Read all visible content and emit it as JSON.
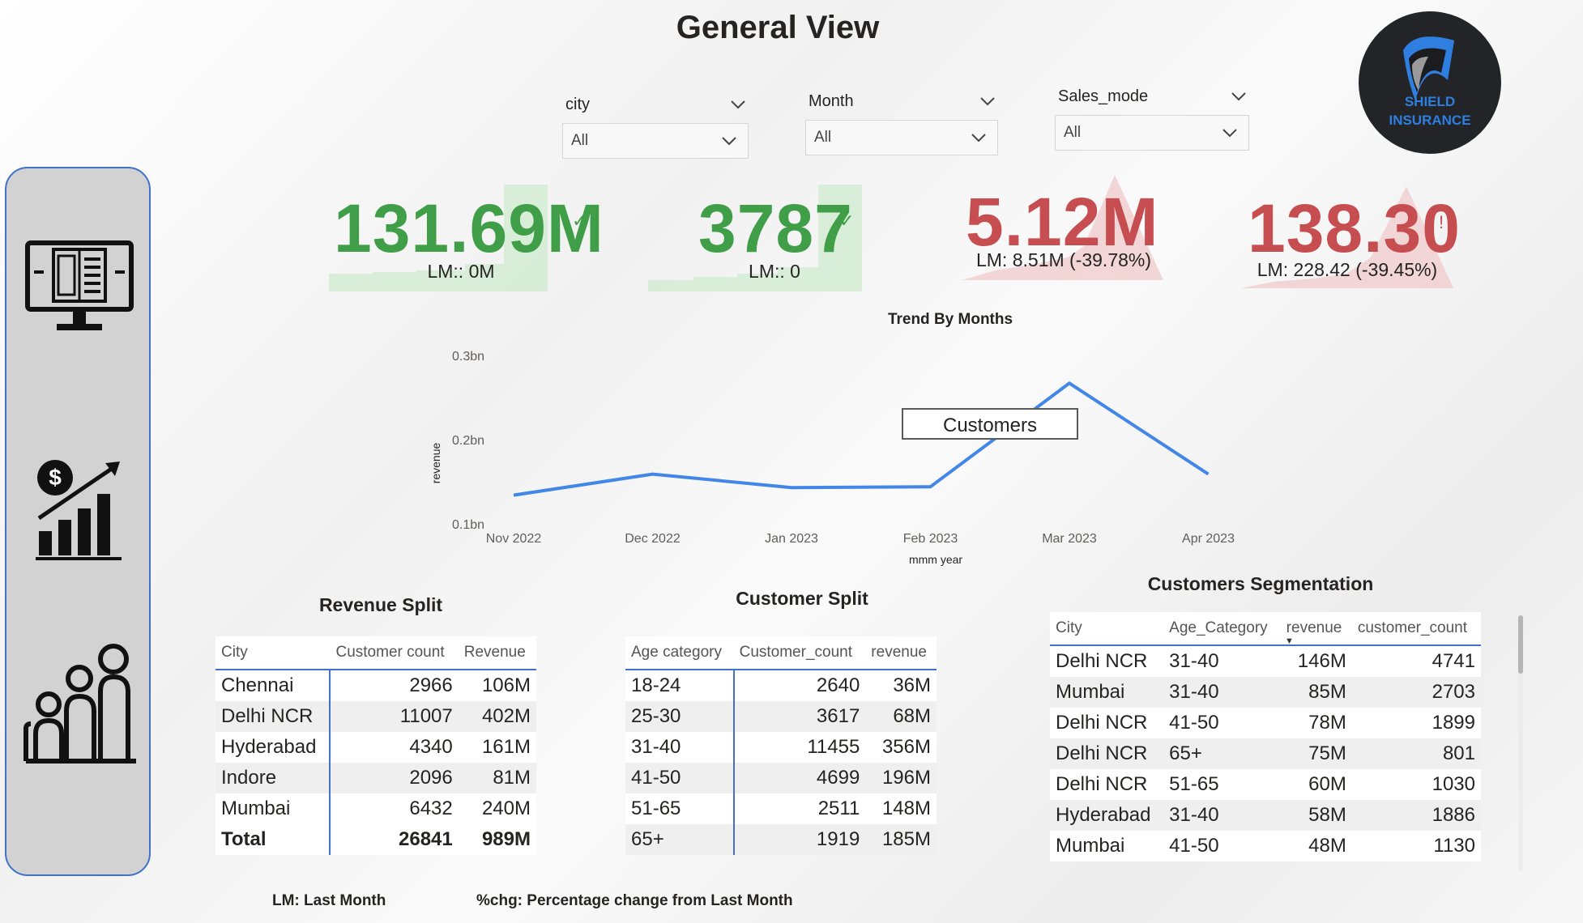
{
  "title": "General View",
  "logo": {
    "line1": "SHIELD",
    "line2": "INSURANCE"
  },
  "slicers": [
    {
      "label": "city",
      "value": "All"
    },
    {
      "label": "Month",
      "value": "All"
    },
    {
      "label": "Sales_mode",
      "value": "All"
    }
  ],
  "kpis": [
    {
      "value": "131.69M",
      "lm": "LM:: 0M",
      "status": "good"
    },
    {
      "value": "3787",
      "lm": "LM:: 0",
      "status": "good"
    },
    {
      "value": "5.12M",
      "lm": "LM: 8.51M (-39.78%)",
      "status": "bad"
    },
    {
      "value": "138.30",
      "lm": "LM: 228.42 (-39.45%)",
      "status": "bad"
    }
  ],
  "chart_data": {
    "type": "line",
    "title": "Trend By Months",
    "xlabel": "mmm year",
    "ylabel": "revenue",
    "categories": [
      "Nov 2022",
      "Dec 2022",
      "Jan 2023",
      "Feb 2023",
      "Mar 2023",
      "Apr 2023"
    ],
    "series": [
      {
        "values": [
          0.135,
          0.16,
          0.144,
          0.145,
          0.268,
          0.16
        ]
      }
    ],
    "yticks": [
      "0.1bn",
      "0.2bn",
      "0.3bn"
    ],
    "ylim": [
      0.1,
      0.3
    ],
    "annotation": "Customers",
    "color": "#4286e8"
  },
  "revenue_split": {
    "title": "Revenue Split",
    "headers": [
      "City",
      "Customer count",
      "Revenue"
    ],
    "rows": [
      [
        "Chennai",
        "2966",
        "106M"
      ],
      [
        "Delhi NCR",
        "11007",
        "402M"
      ],
      [
        "Hyderabad",
        "4340",
        "161M"
      ],
      [
        "Indore",
        "2096",
        "81M"
      ],
      [
        "Mumbai",
        "6432",
        "240M"
      ]
    ],
    "total": [
      "Total",
      "26841",
      "989M"
    ]
  },
  "customer_split": {
    "title": "Customer Split",
    "headers": [
      "Age category",
      "Customer_count",
      "revenue"
    ],
    "rows": [
      [
        "18-24",
        "2640",
        "36M"
      ],
      [
        "25-30",
        "3617",
        "68M"
      ],
      [
        "31-40",
        "11455",
        "356M"
      ],
      [
        "41-50",
        "4699",
        "196M"
      ],
      [
        "51-65",
        "2511",
        "148M"
      ],
      [
        "65+",
        "1919",
        "185M"
      ]
    ]
  },
  "segmentation": {
    "title": "Customers Segmentation",
    "headers": [
      "City",
      "Age_Category",
      "revenue",
      "customer_count"
    ],
    "rows": [
      [
        "Delhi NCR",
        "31-40",
        "146M",
        "4741"
      ],
      [
        "Mumbai",
        "31-40",
        "85M",
        "2703"
      ],
      [
        "Delhi NCR",
        "41-50",
        "78M",
        "1899"
      ],
      [
        "Delhi NCR",
        "65+",
        "75M",
        "801"
      ],
      [
        "Delhi NCR",
        "51-65",
        "60M",
        "1030"
      ],
      [
        "Hyderabad",
        "31-40",
        "58M",
        "1886"
      ],
      [
        "Mumbai",
        "41-50",
        "48M",
        "1130"
      ]
    ]
  },
  "footer": {
    "lm": "LM: Last Month",
    "chg": "%chg: Percentage change from Last Month"
  },
  "icons": {
    "sidebar": [
      "monitor-report-icon",
      "revenue-growth-icon",
      "family-icon"
    ],
    "kpi_good": "checkmark-icon",
    "kpi_bad": "exclamation-icon"
  },
  "colors": {
    "accent": "#3f72c8",
    "good": "#3f9e47",
    "bad": "#c64d50",
    "line": "#4286e8"
  }
}
